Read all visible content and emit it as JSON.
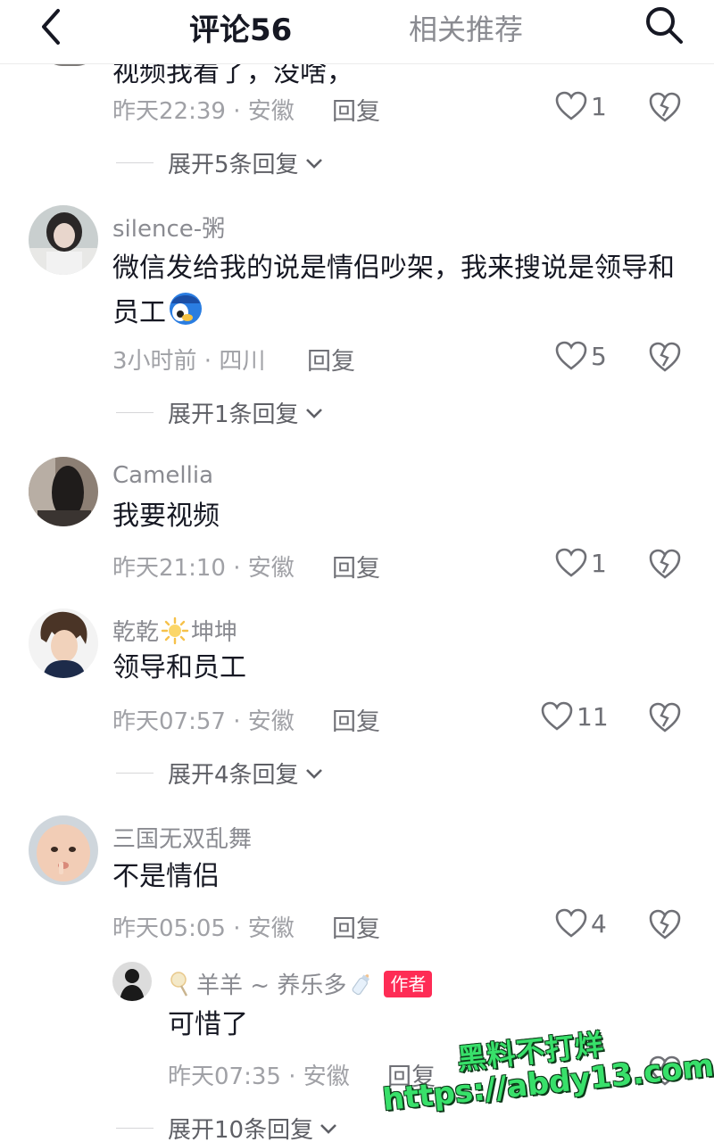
{
  "header": {
    "comments_tab": "评论56",
    "related_tab": "相关推荐"
  },
  "clipped_previous": {
    "text_fragment": "视频我看了，没啥，",
    "meta": "昨天22:39 · 安徽",
    "reply_label": "回复",
    "likes": "1",
    "expand_label": "展开5条回复"
  },
  "comments": [
    {
      "username": "silence-粥",
      "text": "微信发给我的说是情侣吵架，我来搜说是领导和员工",
      "meta": "3小时前 · 四川",
      "reply_label": "回复",
      "likes": "5",
      "expand_label": "展开1条回复"
    },
    {
      "username": "Camellia",
      "text": "我要视频",
      "meta": "昨天21:10 · 安徽",
      "reply_label": "回复",
      "likes": "1"
    },
    {
      "username_part1": "乾乾",
      "username_part2": "坤坤",
      "text": "领导和员工",
      "meta": "昨天07:57 · 安徽",
      "reply_label": "回复",
      "likes": "11",
      "expand_label": "展开4条回复"
    },
    {
      "username": "三国无双乱舞",
      "text": "不是情侣",
      "meta": "昨天05:05 · 安徽",
      "reply_label": "回复",
      "likes": "4",
      "sub_reply": {
        "username": "羊羊 ~ 养乐多",
        "badge": "作者",
        "text": "可惜了",
        "meta": "昨天07:35 · 安徽",
        "reply_label": "回复"
      },
      "expand_label": "展开10条回复"
    }
  ],
  "watermark": {
    "line1": "黑料不打烊",
    "line2": "https://abdy13.com"
  },
  "colors": {
    "primary_text": "#161823",
    "secondary_text": "#8a8b91",
    "author_badge": "#fe2c55",
    "watermark": "#38e06a"
  },
  "icons": [
    "back-arrow-icon",
    "search-icon",
    "heart-icon",
    "broken-heart-icon",
    "chevron-down-icon",
    "sun-emoji-icon",
    "lollipop-emoji-icon",
    "baby-bottle-emoji-icon",
    "emoji-face-icon"
  ]
}
